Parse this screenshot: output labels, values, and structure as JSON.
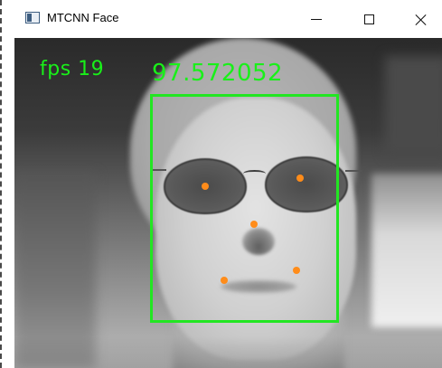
{
  "window": {
    "title": "MTCNN Face",
    "icon": "app-window-icon",
    "controls": {
      "minimize": "minimize-icon",
      "maximize": "maximize-icon",
      "close": "close-icon"
    }
  },
  "overlay": {
    "fps_text": "fps 19",
    "confidence_text": "97.572052",
    "text_color": "#19f019",
    "box_color": "#22e622",
    "landmark_color": "#ff8c1a",
    "landmark_count": 5
  }
}
